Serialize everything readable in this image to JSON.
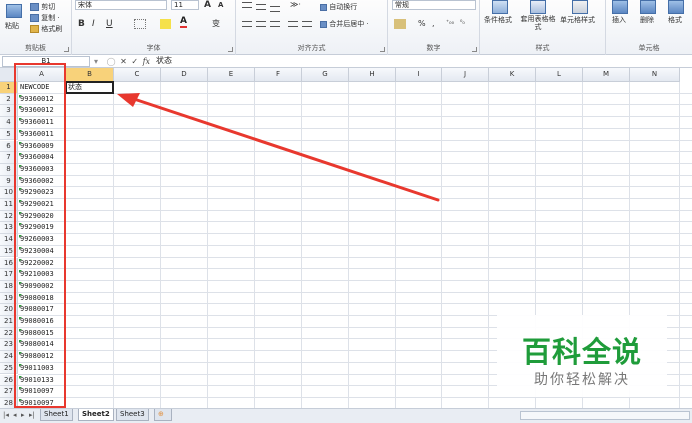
{
  "ribbon": {
    "clipboard": {
      "paste": "粘贴",
      "cut": "剪切",
      "copy": "复制 ·",
      "format_painter": "格式刷",
      "label": "剪贴板"
    },
    "font": {
      "name": "宋体",
      "size": "11",
      "grow": "A",
      "shrink": "A",
      "bold": "B",
      "italic": "I",
      "underline": "U",
      "label": "字体",
      "phonetic": "变"
    },
    "alignment": {
      "wrap": "自动换行",
      "merge": "合并后居中 ·",
      "label": "对齐方式"
    },
    "number": {
      "format": "常规",
      "percent": "%",
      "comma": ",",
      "label": "数字"
    },
    "styles": {
      "conditional": "条件格式",
      "table": "套用表格格式",
      "cell_styles": "单元格样式",
      "label": "样式"
    },
    "cells": {
      "insert": "插入",
      "delete": "删除",
      "format": "格式",
      "label": "单元格"
    }
  },
  "formula_bar": {
    "name_box": "B1",
    "fx": "fx",
    "cancel": "✕",
    "enter": "✓",
    "content": "状态"
  },
  "columns": [
    "A",
    "B",
    "C",
    "D",
    "E",
    "F",
    "G",
    "H",
    "I",
    "J",
    "K",
    "L",
    "M",
    "N"
  ],
  "rows": [
    "1",
    "2",
    "3",
    "4",
    "5",
    "6",
    "7",
    "8",
    "9",
    "10",
    "11",
    "12",
    "13",
    "14",
    "15",
    "16",
    "17",
    "18",
    "19",
    "20",
    "21",
    "22",
    "23",
    "24",
    "25",
    "26",
    "27",
    "28"
  ],
  "cells_A": [
    "NEWCODE",
    "99360012",
    "99360012",
    "99360011",
    "99360011",
    "99360009",
    "99360004",
    "99360003",
    "99360002",
    "99290023",
    "99290021",
    "99290020",
    "99290019",
    "99260003",
    "99230004",
    "99220002",
    "99210003",
    "99090002",
    "99080018",
    "99080017",
    "99080016",
    "99080015",
    "99080014",
    "99080012",
    "99011003",
    "99010133",
    "99010097",
    "99010097"
  ],
  "cell_B1": "状态",
  "sheets": [
    "Sheet1",
    "Sheet2",
    "Sheet3"
  ],
  "watermark": {
    "title": "百科全说",
    "subtitle": "助你轻松解决"
  },
  "colors": {
    "accent_red": "#e8382e",
    "watermark_green": "#1f9c3a",
    "error_triangle": "#2e9a3a"
  }
}
